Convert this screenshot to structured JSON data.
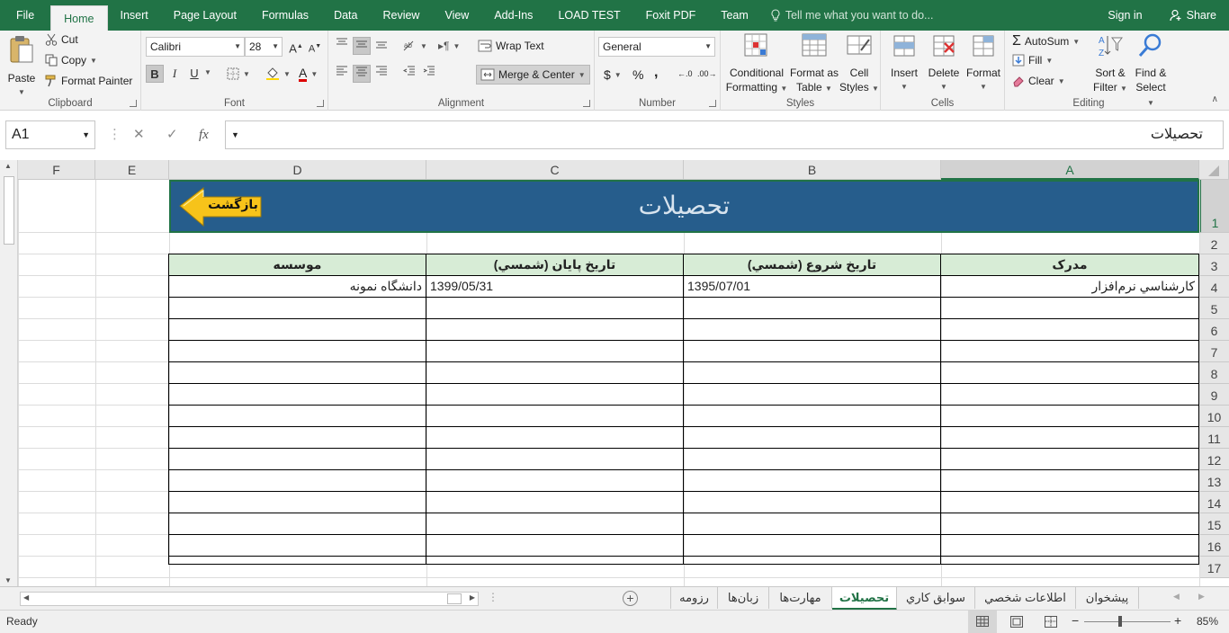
{
  "tabs": {
    "file": "File",
    "home": "Home",
    "insert": "Insert",
    "page_layout": "Page Layout",
    "formulas": "Formulas",
    "data": "Data",
    "review": "Review",
    "view": "View",
    "addins": "Add-Ins",
    "load_test": "LOAD TEST",
    "foxit": "Foxit PDF",
    "team": "Team",
    "tell_me": "Tell me what you want to do...",
    "sign_in": "Sign in",
    "share": "Share"
  },
  "clipboard": {
    "paste": "Paste",
    "cut": "Cut",
    "copy": "Copy",
    "format_painter": "Format Painter",
    "label": "Clipboard"
  },
  "font": {
    "name": "Calibri",
    "size": "28",
    "label": "Font",
    "bold": "B",
    "italic": "I",
    "underline": "U"
  },
  "alignment": {
    "wrap_text": "Wrap Text",
    "merge_center": "Merge & Center",
    "label": "Alignment"
  },
  "number": {
    "format": "General",
    "label": "Number",
    "currency": "$",
    "percent": "%",
    "comma": ","
  },
  "styles": {
    "conditional": "Conditional",
    "formatting": "Formatting",
    "format_as": "Format as",
    "table": "Table",
    "cell": "Cell",
    "styles_word": "Styles",
    "label": "Styles"
  },
  "cells": {
    "insert": "Insert",
    "delete": "Delete",
    "format": "Format",
    "label": "Cells"
  },
  "editing": {
    "autosum": "AutoSum",
    "fill": "Fill",
    "clear": "Clear",
    "sort": "Sort &",
    "filter": "Filter",
    "find": "Find &",
    "select": "Select",
    "label": "Editing"
  },
  "formula_bar": {
    "name_box": "A1",
    "fx": "fx",
    "value": "تحصيلات"
  },
  "columns": [
    "A",
    "B",
    "C",
    "D",
    "E",
    "F"
  ],
  "rows": [
    "1",
    "2",
    "3",
    "4",
    "5",
    "6",
    "7",
    "8",
    "9",
    "10",
    "11",
    "12",
    "13",
    "14",
    "15",
    "16",
    "17"
  ],
  "sheet": {
    "title": "تحصيلات",
    "back_button": "بازگشت",
    "headers": {
      "a": "مدرک",
      "b": "تاريخ شروع (شمسي)",
      "c": "تاريخ پايان (شمسي)",
      "d": "موسسه"
    },
    "row4": {
      "a": "کارشناسي نرم‌افزار",
      "b": "1395/07/01",
      "c": "1399/05/31",
      "d": "دانشگاه نمونه"
    }
  },
  "sheet_tabs": [
    "پيشخوان",
    "اطلاعات شخصي",
    "سوابق کاري",
    "تحصيلات",
    "مهارت‌ها",
    "زبان‌ها",
    "رزومه"
  ],
  "status": {
    "ready": "Ready",
    "zoom": "85%"
  },
  "colors": {
    "excel_green": "#217346",
    "banner_blue": "#265d8c",
    "header_fill": "#d7ecd6",
    "arrow_yellow": "#f7c31a"
  }
}
